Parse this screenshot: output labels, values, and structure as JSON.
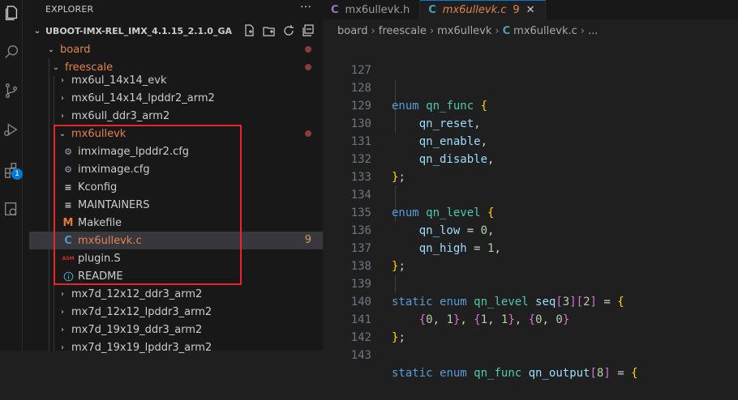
{
  "explorer": {
    "title": "EXPLORER",
    "more": "···",
    "root": "UBOOT-IMX-REL_IMX_4.1.15_2.1.0_GA"
  },
  "activity_bar": {
    "extensions_badge": "1"
  },
  "tree": {
    "board": "board",
    "freescale": "freescale",
    "items_before": [
      "mx6ul_14x14_evk",
      "mx6ul_14x14_lpddr2_arm2",
      "mx6ull_ddr3_arm2"
    ],
    "folder": "mx6ullevk",
    "files": [
      {
        "name": "imximage_lpddr2.cfg",
        "icon": "gear-icon"
      },
      {
        "name": "imximage.cfg",
        "icon": "gear-icon"
      },
      {
        "name": "Kconfig",
        "icon": "lines-icon"
      },
      {
        "name": "MAINTAINERS",
        "icon": "lines-icon"
      },
      {
        "name": "Makefile",
        "icon": "makefile-icon"
      },
      {
        "name": "mx6ullevk.c",
        "icon": "c-file-icon",
        "count": "9"
      },
      {
        "name": "plugin.S",
        "icon": "asm-icon"
      },
      {
        "name": "README",
        "icon": "info-icon"
      }
    ],
    "items_after": [
      "mx7d_12x12_ddr3_arm2",
      "mx7d_12x12_lpddr3_arm2",
      "mx7d_19x19_ddr3_arm2",
      "mx7d_19x19_lpddr3_arm2"
    ]
  },
  "tabs": [
    {
      "label": "mx6ullevk.h",
      "active": false
    },
    {
      "label": "mx6ullevk.c",
      "active": true,
      "problems": "9",
      "close": "✕"
    }
  ],
  "breadcrumb": [
    "board",
    "freescale",
    "mx6ullevk",
    "mx6ullevk.c",
    "..."
  ],
  "code": {
    "line_numbers": [
      "127",
      "128",
      "129",
      "130",
      "131",
      "132",
      "133",
      "134",
      "135",
      "136",
      "137",
      "138",
      "139",
      "140",
      "141",
      "142",
      "143"
    ],
    "enum_func": "qn_func",
    "func_members": [
      "qn_reset",
      "qn_enable",
      "qn_disable"
    ],
    "enum_level": "qn_level",
    "level_members": [
      {
        "name": "qn_low",
        "value": "0"
      },
      {
        "name": "qn_high",
        "value": "1"
      }
    ],
    "seq_name": "seq",
    "seq_dims": [
      "3",
      "2"
    ],
    "seq_values": [
      [
        "0",
        "1"
      ],
      [
        "1",
        "1"
      ],
      [
        "0",
        "0"
      ]
    ],
    "output_name": "qn_output",
    "output_dim": "8"
  }
}
